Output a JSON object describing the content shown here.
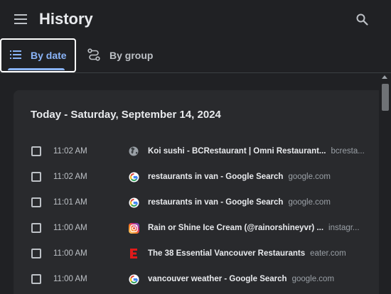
{
  "header": {
    "title": "History",
    "menu_icon": "hamburger-menu-icon",
    "search_icon": "search-icon"
  },
  "tabs": [
    {
      "label": "By date",
      "icon": "list-icon",
      "selected": true
    },
    {
      "label": "By group",
      "icon": "journeys-icon",
      "selected": false
    }
  ],
  "colors": {
    "accent": "#8ab4f8",
    "background": "#202124",
    "card": "#292a2d",
    "text": "#e8eaed",
    "secondary_text": "#9aa0a6"
  },
  "card": {
    "title": "Today - Saturday, September 14, 2024",
    "entries": [
      {
        "time": "11:02 AM",
        "title": "Koi sushi - BCRestaurant | Omni Restaurant...",
        "domain": "bcresta...",
        "favicon": "globe-icon"
      },
      {
        "time": "11:02 AM",
        "title": "restaurants in van - Google Search",
        "domain": "google.com",
        "favicon": "google-icon"
      },
      {
        "time": "11:01 AM",
        "title": "restaurants in van - Google Search",
        "domain": "google.com",
        "favicon": "google-icon"
      },
      {
        "time": "11:00 AM",
        "title": "Rain or Shine Ice Cream (@rainorshineyvr) ...",
        "domain": "instagr...",
        "favicon": "instagram-icon"
      },
      {
        "time": "11:00 AM",
        "title": "The 38 Essential Vancouver Restaurants",
        "domain": "eater.com",
        "favicon": "eater-icon"
      },
      {
        "time": "11:00 AM",
        "title": "vancouver weather - Google Search",
        "domain": "google.com",
        "favicon": "google-icon"
      }
    ]
  }
}
